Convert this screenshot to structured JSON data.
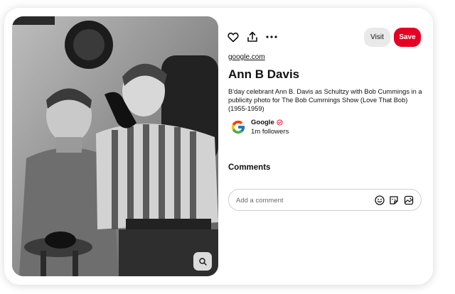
{
  "pin": {
    "source_link": "google.com",
    "title": "Ann B Davis",
    "description": "B'day celebrant Ann B. Davis as Schultzy with Bob Cummings in a publicity photo for The Bob Cummings Show (Love That Bob) (1955-1959)"
  },
  "actions": {
    "visit_label": "Visit",
    "save_label": "Save",
    "icons": [
      "heart-icon",
      "share-icon",
      "more-icon"
    ]
  },
  "creator": {
    "name": "Google",
    "followers": "1m followers",
    "verified": true,
    "logo": "google-g-logo"
  },
  "comments": {
    "heading": "Comments",
    "placeholder": "Add a comment",
    "icons": [
      "emoji-icon",
      "sticker-icon",
      "image-icon"
    ]
  },
  "colors": {
    "save": "#e60023",
    "visit": "#e9e9e9",
    "verified": "#e60023"
  }
}
